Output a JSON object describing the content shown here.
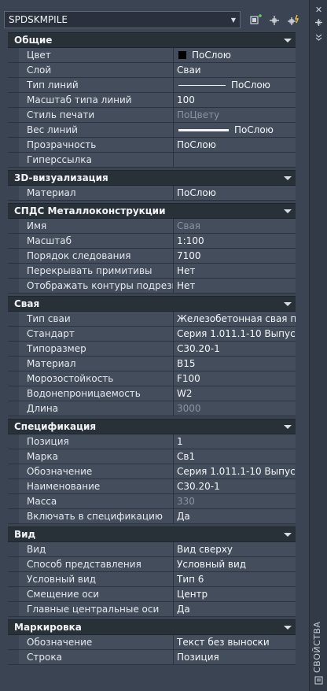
{
  "toolbar": {
    "object_type": "SPDSKMPILE",
    "icons": [
      "quick-select-icon",
      "select-objects-icon",
      "toggle-pickadd-icon"
    ]
  },
  "sidebar": {
    "label": "СВОЙСТВА",
    "icons": [
      "close-icon",
      "pin-icon",
      "settings-icon"
    ]
  },
  "categories": [
    {
      "title": "Общие",
      "rows": [
        {
          "name": "Цвет",
          "value": "ПоСлою",
          "type": "color"
        },
        {
          "name": "Слой",
          "value": "Сваи"
        },
        {
          "name": "Тип линий",
          "value": "ПоСлою",
          "type": "line"
        },
        {
          "name": "Масштаб типа линий",
          "value": "100"
        },
        {
          "name": "Стиль печати",
          "value": "ПоЦвету",
          "readonly": true
        },
        {
          "name": "Вес линий",
          "value": "ПоСлою",
          "type": "weight"
        },
        {
          "name": "Прозрачность",
          "value": "ПоСлою"
        },
        {
          "name": "Гиперссылка",
          "value": ""
        }
      ]
    },
    {
      "title": "3D-визуализация",
      "rows": [
        {
          "name": "Материал",
          "value": "ПоСлою"
        }
      ]
    },
    {
      "title": "СПДС Металлоконструкции",
      "rows": [
        {
          "name": "Имя",
          "value": "Свая",
          "readonly": true
        },
        {
          "name": "Масштаб",
          "value": "1:100"
        },
        {
          "name": "Порядок следования",
          "value": "7100"
        },
        {
          "name": "Перекрывать примитивы",
          "value": "Нет"
        },
        {
          "name": "Отображать контуры подрезки",
          "value": "Нет"
        }
      ]
    },
    {
      "title": "Свая",
      "rows": [
        {
          "name": "Тип сваи",
          "value": "Железобетонная  свая  п..."
        },
        {
          "name": "Стандарт",
          "value": "Серия 1.011.1-10 Выпус..."
        },
        {
          "name": "Типоразмер",
          "value": "С30.20-1"
        },
        {
          "name": "Материал",
          "value": "В15"
        },
        {
          "name": "Морозостойкость",
          "value": "F100"
        },
        {
          "name": "Водонепроницаемость",
          "value": "W2"
        },
        {
          "name": "Длина",
          "value": "3000",
          "readonly": true
        }
      ]
    },
    {
      "title": "Спецификация",
      "rows": [
        {
          "name": "Позиция",
          "value": "1"
        },
        {
          "name": "Марка",
          "value": "Св1"
        },
        {
          "name": "Обозначение",
          "value": "Серия 1.011.1-10 Выпус..."
        },
        {
          "name": "Наименование",
          "value": "С30.20-1"
        },
        {
          "name": "Масса",
          "value": "330",
          "readonly": true
        },
        {
          "name": "Включать в спецификацию",
          "value": "Да"
        }
      ]
    },
    {
      "title": "Вид",
      "rows": [
        {
          "name": "Вид",
          "value": "Вид сверху"
        },
        {
          "name": "Способ представления",
          "value": "Условный вид"
        },
        {
          "name": "Условный вид",
          "value": "Тип 6"
        },
        {
          "name": "Смещение оси",
          "value": "Центр"
        },
        {
          "name": "Главные центральные оси",
          "value": "Да"
        }
      ]
    },
    {
      "title": "Маркировка",
      "rows": [
        {
          "name": "Обозначение",
          "value": "Текст без выноски"
        },
        {
          "name": "Строка",
          "value": "Позиция"
        }
      ]
    }
  ]
}
